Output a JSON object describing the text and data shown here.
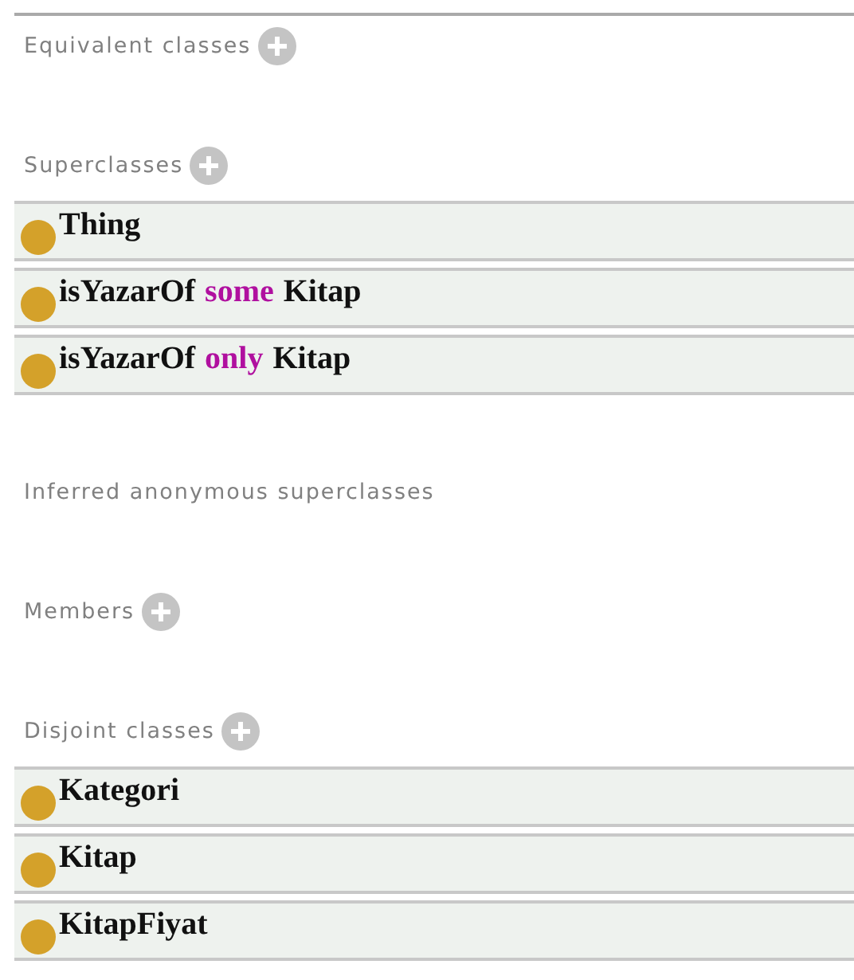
{
  "sections": [
    {
      "title": "Equivalent classes",
      "add_button": true
    },
    {
      "title": "Superclasses",
      "add_button": true,
      "items": [
        [
          {
            "kind": "name",
            "text": "Thing"
          }
        ],
        [
          {
            "kind": "name",
            "text": "isYazarOf"
          },
          {
            "kind": "keyword",
            "text": "some"
          },
          {
            "kind": "name",
            "text": "Kitap"
          }
        ],
        [
          {
            "kind": "name",
            "text": "isYazarOf"
          },
          {
            "kind": "keyword",
            "text": "only"
          },
          {
            "kind": "name",
            "text": "Kitap"
          }
        ]
      ]
    },
    {
      "title": "Inferred anonymous superclasses",
      "add_button": false
    },
    {
      "title": "Members",
      "add_button": true
    },
    {
      "title": "Disjoint classes",
      "add_button": true,
      "items": [
        [
          {
            "kind": "name",
            "text": "Kategori"
          }
        ],
        [
          {
            "kind": "name",
            "text": "Kitap"
          }
        ],
        [
          {
            "kind": "name",
            "text": "KitapFiyat"
          }
        ]
      ]
    }
  ]
}
